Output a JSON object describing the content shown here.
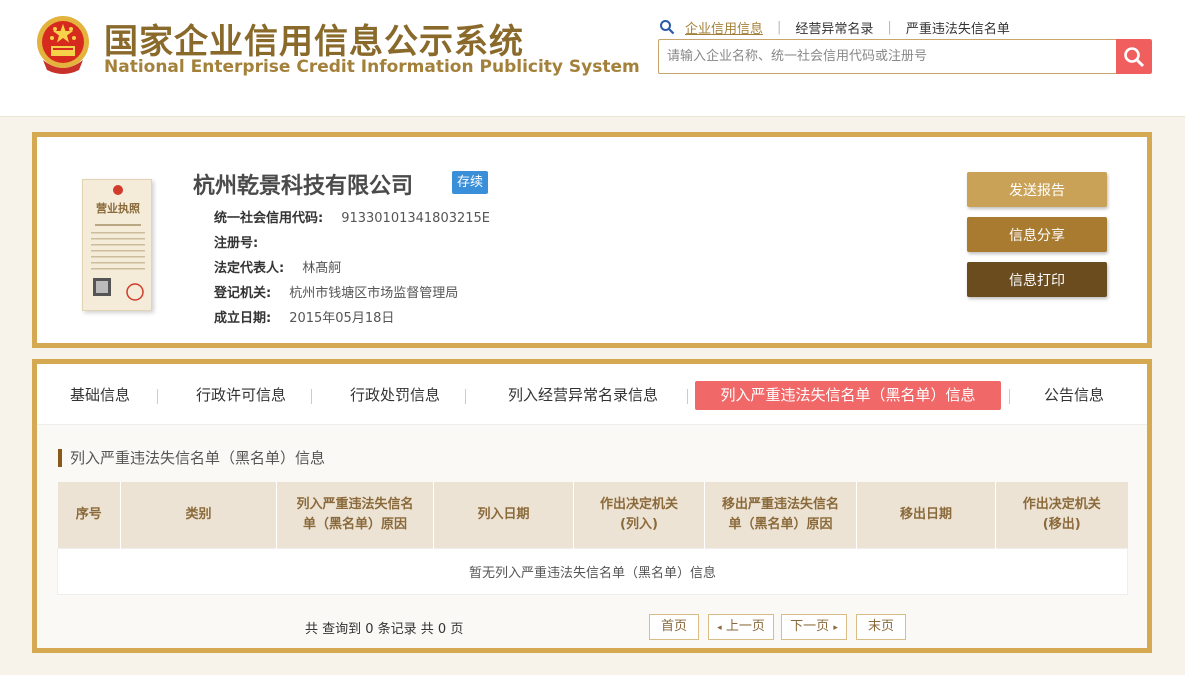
{
  "header": {
    "title_cn": "国家企业信用信息公示系统",
    "title_en": "National Enterprise Credit Information Publicity System",
    "nav": [
      {
        "label": "企业信用信息",
        "active": true
      },
      {
        "label": "经营异常名录",
        "active": false
      },
      {
        "label": "严重违法失信名单",
        "active": false
      }
    ],
    "search_placeholder": "请输入企业名称、统一社会信用代码或注册号"
  },
  "company": {
    "name": "杭州乾景科技有限公司",
    "status": "存续",
    "license_label": "营业执照",
    "fields": [
      {
        "key": "统一社会信用代码:",
        "value": "91330101341803215E"
      },
      {
        "key": "注册号:",
        "value": ""
      },
      {
        "key": "法定代表人:",
        "value": "林髙舸"
      },
      {
        "key": "登记机关:",
        "value": "杭州市钱塘区市场监督管理局"
      },
      {
        "key": "成立日期:",
        "value": "2015年05月18日"
      }
    ],
    "buttons": {
      "send": "发送报告",
      "share": "信息分享",
      "print": "信息打印"
    }
  },
  "tabs": [
    {
      "label": "基础信息",
      "active": false
    },
    {
      "label": "行政许可信息",
      "active": false
    },
    {
      "label": "行政处罚信息",
      "active": false
    },
    {
      "label": "列入经营异常名录信息",
      "active": false
    },
    {
      "label": "列入严重违法失信名单（黑名单）信息",
      "active": true
    },
    {
      "label": "公告信息",
      "active": false
    }
  ],
  "section": {
    "title": "列入严重违法失信名单（黑名单）信息",
    "columns": [
      {
        "l1": "序号",
        "l2": ""
      },
      {
        "l1": "类别",
        "l2": ""
      },
      {
        "l1": "列入严重违法失信名",
        "l2": "单（黑名单）原因"
      },
      {
        "l1": "列入日期",
        "l2": ""
      },
      {
        "l1": "作出决定机关",
        "l2": "(列入)"
      },
      {
        "l1": "移出严重违法失信名",
        "l2": "单（黑名单）原因"
      },
      {
        "l1": "移出日期",
        "l2": ""
      },
      {
        "l1": "作出决定机关",
        "l2": "(移出)"
      }
    ],
    "empty_text": "暂无列入严重违法失信名单（黑名单）信息"
  },
  "pagination": {
    "summary": "共 查询到 0 条记录 共 0 页",
    "first": "首页",
    "prev": "上一页",
    "next": "下一页",
    "last": "末页"
  },
  "colors": {
    "accent": "#d5a951",
    "active_tab": "#f06868",
    "badge": "#3a8fd9"
  }
}
